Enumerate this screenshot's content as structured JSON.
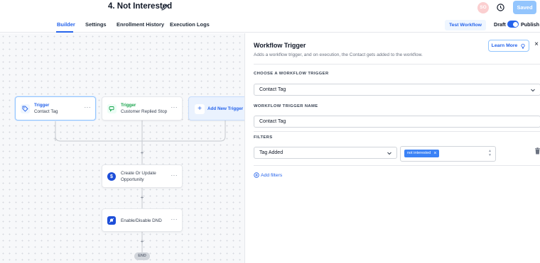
{
  "header": {
    "workflow_title": "4. Not Interested",
    "avatar_initials": "SO",
    "saved_label": "Saved"
  },
  "tabs": [
    {
      "label": "Builder",
      "active": true
    },
    {
      "label": "Settings"
    },
    {
      "label": "Enrollment History"
    },
    {
      "label": "Execution Logs"
    }
  ],
  "toolbar": {
    "test_workflow_label": "Test Workflow",
    "draft_label": "Draft",
    "publish_label": "Publish",
    "publish_toggle_on": true
  },
  "canvas": {
    "triggers": [
      {
        "type": "Trigger",
        "name": "Contact Tag",
        "icon": "tag-icon"
      },
      {
        "type": "Trigger",
        "name": "Customer Replied Stop",
        "icon": "chat-icon"
      }
    ],
    "add_trigger_label": "Add New Trigger",
    "actions": [
      {
        "name_line1": "Create Or Update",
        "name_line2": "Opportunity",
        "icon": "dollar-icon"
      },
      {
        "name_line1": "Enable/Disable DND",
        "icon": "bell-off-icon"
      }
    ],
    "node_menu": "···",
    "plus": "+",
    "end_label": "END"
  },
  "panel": {
    "title": "Workflow Trigger",
    "subtitle": "Adds a workflow trigger, and on execution, the Contact gets added to the workflow.",
    "learn_more_label": "Learn More",
    "close_label": "×",
    "choose_label": "CHOOSE A WORKFLOW TRIGGER",
    "choose_value": "Contact Tag",
    "name_label": "WORKFLOW TRIGGER NAME",
    "name_value": "Contact Tag",
    "filters_label": "FILTERS",
    "filter_field": "Tag Added",
    "filter_tags": [
      "not interested"
    ],
    "add_filters_label": "Add filters"
  },
  "colors": {
    "accent": "#2563eb",
    "trigger_tag": "#2563eb",
    "trigger_chat": "#16a34a"
  }
}
